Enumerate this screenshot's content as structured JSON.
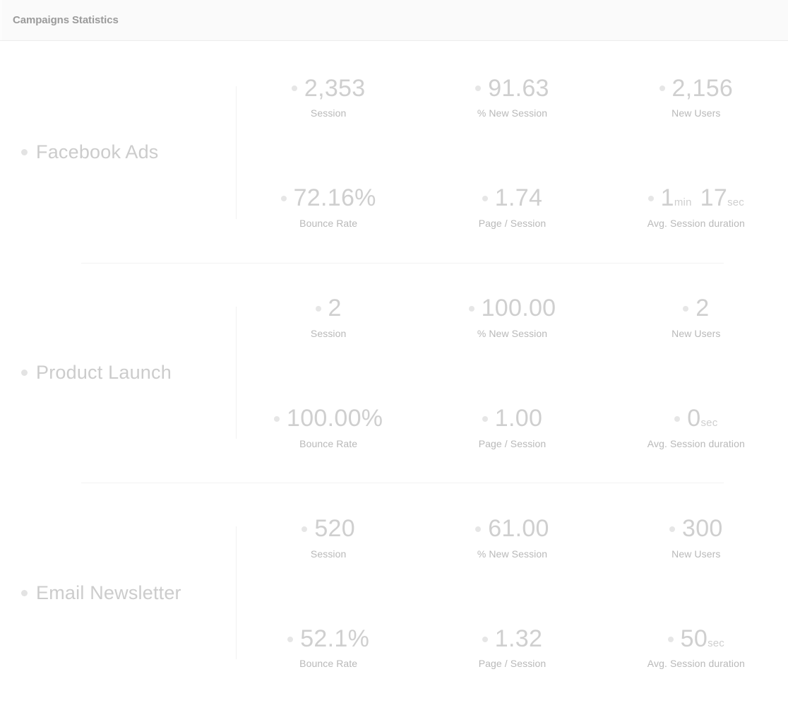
{
  "header": {
    "title": "Campaigns Statistics"
  },
  "colors": {
    "header_bg": "#fafafa",
    "header_text": "#9b9b9b",
    "value_text": "#cfcfcf",
    "label_text": "#b9b9b9",
    "campaign_text": "#cccccc",
    "bullet": "#e6e6e6",
    "divider": "#f1f1f1"
  },
  "campaigns": [
    {
      "name": "Facebook Ads",
      "metrics": [
        {
          "value": "2,353",
          "unit": "",
          "value2": "",
          "unit2": "",
          "label": "Session"
        },
        {
          "value": "91.63",
          "unit": "",
          "value2": "",
          "unit2": "",
          "label": "% New Session"
        },
        {
          "value": "2,156",
          "unit": "",
          "value2": "",
          "unit2": "",
          "label": "New Users"
        },
        {
          "value": "72.16%",
          "unit": "",
          "value2": "",
          "unit2": "",
          "label": "Bounce Rate"
        },
        {
          "value": "1.74",
          "unit": "",
          "value2": "",
          "unit2": "",
          "label": "Page / Session"
        },
        {
          "value": "1",
          "unit": "min",
          "value2": "17",
          "unit2": "sec",
          "label": "Avg. Session duration"
        }
      ]
    },
    {
      "name": "Product Launch",
      "metrics": [
        {
          "value": "2",
          "unit": "",
          "value2": "",
          "unit2": "",
          "label": "Session"
        },
        {
          "value": "100.00",
          "unit": "",
          "value2": "",
          "unit2": "",
          "label": "% New Session"
        },
        {
          "value": "2",
          "unit": "",
          "value2": "",
          "unit2": "",
          "label": "New Users"
        },
        {
          "value": "100.00%",
          "unit": "",
          "value2": "",
          "unit2": "",
          "label": "Bounce Rate"
        },
        {
          "value": "1.00",
          "unit": "",
          "value2": "",
          "unit2": "",
          "label": "Page / Session"
        },
        {
          "value": "0",
          "unit": "sec",
          "value2": "",
          "unit2": "",
          "label": "Avg. Session duration"
        }
      ]
    },
    {
      "name": "Email Newsletter",
      "metrics": [
        {
          "value": "520",
          "unit": "",
          "value2": "",
          "unit2": "",
          "label": "Session"
        },
        {
          "value": "61.00",
          "unit": "",
          "value2": "",
          "unit2": "",
          "label": "% New Session"
        },
        {
          "value": "300",
          "unit": "",
          "value2": "",
          "unit2": "",
          "label": "New Users"
        },
        {
          "value": "52.1%",
          "unit": "",
          "value2": "",
          "unit2": "",
          "label": "Bounce Rate"
        },
        {
          "value": "1.32",
          "unit": "",
          "value2": "",
          "unit2": "",
          "label": "Page / Session"
        },
        {
          "value": "50",
          "unit": "sec",
          "value2": "",
          "unit2": "",
          "label": "Avg. Session duration"
        }
      ]
    }
  ]
}
